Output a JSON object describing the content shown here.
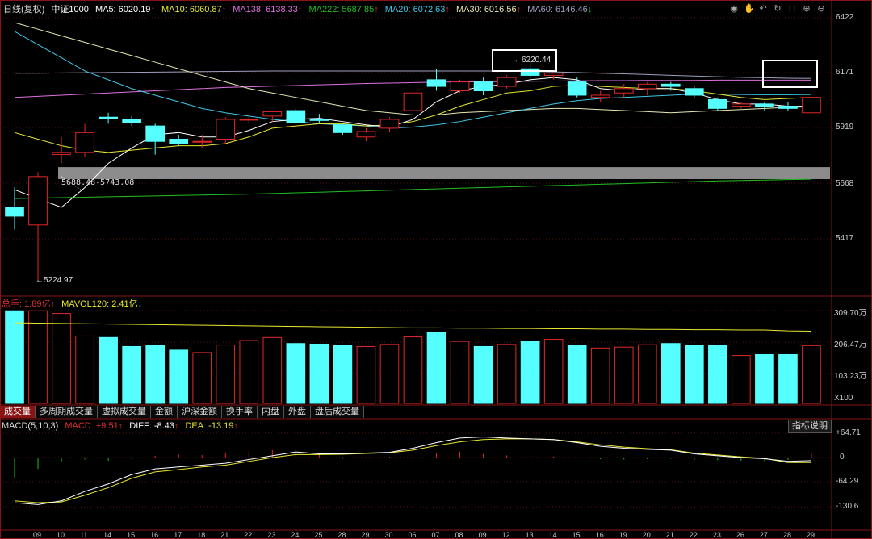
{
  "header": {
    "period": "日线(复权)",
    "index_name": "中证1000",
    "ma5": "MA5: 6020.19",
    "ma10": "MA10: 6060.87",
    "ma138": "MA138: 6138.33",
    "ma222": "MA222: 5687.85",
    "ma20": "MA20: 6072.63",
    "ma30": "MA30: 6016.56",
    "ma60": "MA60: 6146.46",
    "up_arrow": "↑",
    "down_arrow": "↓"
  },
  "toolbar_icons": [
    "eye-icon",
    "hand-icon",
    "undo-icon",
    "refresh-icon",
    "lock-icon",
    "zoom-in-icon",
    "zoom-out-icon"
  ],
  "price_axis": [
    "6422",
    "6171",
    "5919",
    "5668",
    "5417"
  ],
  "annotations": {
    "high_label": "6220.44",
    "low_label": "5224.97",
    "gap_label": "5688.48-5743.08"
  },
  "volume_header": {
    "total": "总手: 1.89亿",
    "mavol": "MAVOL120: 2.41亿"
  },
  "volume_axis": [
    "309.70万",
    "206.47万",
    "103.23万",
    "X100"
  ],
  "tabs": [
    "成交量",
    "多周期成交量",
    "虚拟成交量",
    "金额",
    "沪深金额",
    "换手率",
    "内盘",
    "外盘",
    "盘后成交量"
  ],
  "macd_header": {
    "name": "MACD(5,10,3)",
    "macd": "MACD: +9.51",
    "diff": "DIFF: -8.43",
    "dea": "DEA: -13.19"
  },
  "indicator_button": "指标说明",
  "macd_axis": [
    "+64.71",
    "0",
    "-64.29",
    "-130.6"
  ],
  "date_axis": [
    "09",
    "10",
    "11",
    "14",
    "15",
    "16",
    "17",
    "18",
    "21",
    "22",
    "23",
    "24",
    "25",
    "28",
    "29",
    "30",
    "06",
    "07",
    "08",
    "09",
    "12",
    "13",
    "14",
    "15",
    "16",
    "19",
    "20",
    "21",
    "22",
    "23",
    "26",
    "27",
    "28",
    "29"
  ],
  "colors": {
    "up": "#e02828",
    "down": "#55ffff",
    "ma5": "#ffffff",
    "ma10": "#e8e830",
    "ma20": "#40c8e8",
    "ma30": "#e8e8b0",
    "ma60": "#a0a0c0",
    "ma138": "#e070e0",
    "ma222": "#20c020",
    "diff": "#ffffff",
    "dea": "#e8e830"
  },
  "chart_data": {
    "type": "candlestick",
    "price_range": [
      5224.97,
      6422
    ],
    "candles": [
      {
        "o": 5560,
        "h": 5650,
        "l": 5460,
        "c": 5520
      },
      {
        "o": 5480,
        "h": 5720,
        "l": 5225,
        "c": 5700
      },
      {
        "o": 5800,
        "h": 5880,
        "l": 5760,
        "c": 5810
      },
      {
        "o": 5810,
        "h": 5940,
        "l": 5790,
        "c": 5900
      },
      {
        "o": 5970,
        "h": 5990,
        "l": 5940,
        "c": 5965
      },
      {
        "o": 5960,
        "h": 5975,
        "l": 5930,
        "c": 5945
      },
      {
        "o": 5930,
        "h": 5940,
        "l": 5800,
        "c": 5860
      },
      {
        "o": 5870,
        "h": 5890,
        "l": 5840,
        "c": 5850
      },
      {
        "o": 5860,
        "h": 5890,
        "l": 5830,
        "c": 5860
      },
      {
        "o": 5870,
        "h": 5970,
        "l": 5850,
        "c": 5960
      },
      {
        "o": 5960,
        "h": 5985,
        "l": 5940,
        "c": 5960
      },
      {
        "o": 5975,
        "h": 6000,
        "l": 5950,
        "c": 5995
      },
      {
        "o": 6000,
        "h": 6010,
        "l": 5940,
        "c": 5945
      },
      {
        "o": 5960,
        "h": 5985,
        "l": 5940,
        "c": 5955
      },
      {
        "o": 5935,
        "h": 5945,
        "l": 5890,
        "c": 5900
      },
      {
        "o": 5880,
        "h": 5920,
        "l": 5860,
        "c": 5905
      },
      {
        "o": 5920,
        "h": 5970,
        "l": 5900,
        "c": 5960
      },
      {
        "o": 6000,
        "h": 6090,
        "l": 5980,
        "c": 6080
      },
      {
        "o": 6140,
        "h": 6190,
        "l": 6090,
        "c": 6110
      },
      {
        "o": 6090,
        "h": 6140,
        "l": 6080,
        "c": 6130
      },
      {
        "o": 6130,
        "h": 6150,
        "l": 6070,
        "c": 6090
      },
      {
        "o": 6110,
        "h": 6160,
        "l": 6100,
        "c": 6150
      },
      {
        "o": 6190,
        "h": 6220,
        "l": 6140,
        "c": 6160
      },
      {
        "o": 6160,
        "h": 6180,
        "l": 6140,
        "c": 6170
      },
      {
        "o": 6130,
        "h": 6150,
        "l": 6060,
        "c": 6070
      },
      {
        "o": 6060,
        "h": 6090,
        "l": 6040,
        "c": 6070
      },
      {
        "o": 6080,
        "h": 6120,
        "l": 6060,
        "c": 6100
      },
      {
        "o": 6100,
        "h": 6130,
        "l": 6070,
        "c": 6120
      },
      {
        "o": 6120,
        "h": 6130,
        "l": 6090,
        "c": 6110
      },
      {
        "o": 6100,
        "h": 6110,
        "l": 6060,
        "c": 6070
      },
      {
        "o": 6050,
        "h": 6060,
        "l": 6000,
        "c": 6010
      },
      {
        "o": 6020,
        "h": 6040,
        "l": 6010,
        "c": 6030
      },
      {
        "o": 6030,
        "h": 6040,
        "l": 6000,
        "c": 6020
      },
      {
        "o": 6020,
        "h": 6040,
        "l": 6000,
        "c": 6010
      },
      {
        "o": 5990,
        "h": 6060,
        "l": 5990,
        "c": 6060
      }
    ],
    "ma_lines": {
      "ma5": [
        5640,
        5600,
        5560,
        5650,
        5760,
        5830,
        5890,
        5900,
        5880,
        5880,
        5910,
        5950,
        5960,
        5965,
        5950,
        5935,
        5925,
        5960,
        6040,
        6090,
        6110,
        6120,
        6140,
        6150,
        6140,
        6100,
        6090,
        6100,
        6100,
        6080,
        6050,
        6030,
        6030,
        6020,
        6020
      ],
      "ma10": [
        5900,
        5870,
        5840,
        5820,
        5810,
        5820,
        5830,
        5840,
        5840,
        5850,
        5880,
        5920,
        5930,
        5940,
        5940,
        5930,
        5935,
        5950,
        5980,
        6020,
        6050,
        6080,
        6090,
        6110,
        6115,
        6110,
        6105,
        6100,
        6100,
        6090,
        6075,
        6060,
        6050,
        6055,
        6060
      ],
      "ma20": [
        6360,
        6300,
        6240,
        6180,
        6140,
        6100,
        6070,
        6040,
        6010,
        5990,
        5975,
        5960,
        5950,
        5940,
        5935,
        5930,
        5920,
        5925,
        5935,
        5950,
        5970,
        5990,
        6010,
        6030,
        6045,
        6055,
        6060,
        6065,
        6070,
        6075,
        6075,
        6073,
        6072,
        6072,
        6073
      ],
      "ma30": [
        6400,
        6370,
        6340,
        6310,
        6280,
        6250,
        6220,
        6190,
        6160,
        6130,
        6100,
        6080,
        6060,
        6040,
        6020,
        6000,
        5990,
        5980,
        5980,
        5990,
        5995,
        6000,
        6005,
        6010,
        6010,
        6005,
        6000,
        5995,
        5990,
        5995,
        6000,
        6005,
        6010,
        6015,
        6017
      ],
      "ma60": [
        6170,
        6170,
        6171,
        6172,
        6173,
        6174,
        6175,
        6176,
        6177,
        6178,
        6179,
        6180,
        6180,
        6180,
        6180,
        6180,
        6180,
        6180,
        6180,
        6180,
        6180,
        6180,
        6178,
        6176,
        6173,
        6170,
        6167,
        6164,
        6160,
        6157,
        6154,
        6151,
        6149,
        6147,
        6146
      ],
      "ma138": [
        6060,
        6065,
        6070,
        6075,
        6080,
        6085,
        6090,
        6095,
        6100,
        6105,
        6108,
        6111,
        6114,
        6117,
        6120,
        6123,
        6125,
        6127,
        6129,
        6130,
        6131,
        6132,
        6133,
        6134,
        6135,
        6136,
        6136,
        6137,
        6137,
        6137,
        6138,
        6138,
        6138,
        6138,
        6138
      ],
      "ma222": [
        5600,
        5602,
        5604,
        5606,
        5608,
        5610,
        5612,
        5614,
        5616,
        5618,
        5620,
        5623,
        5626,
        5629,
        5632,
        5635,
        5638,
        5641,
        5644,
        5647,
        5650,
        5653,
        5656,
        5659,
        5662,
        5665,
        5668,
        5671,
        5674,
        5677,
        5680,
        5682,
        5684,
        5686,
        5688
      ]
    },
    "volume": [
      309,
      309,
      300,
      225,
      220,
      190,
      193,
      178,
      170,
      195,
      210,
      220,
      200,
      198,
      195,
      190,
      197,
      222,
      237,
      207,
      190,
      197,
      207,
      214,
      195,
      185,
      188,
      196,
      200,
      195,
      193,
      160,
      163,
      163,
      193
    ],
    "volume_ma": [
      269,
      268,
      267,
      266,
      265,
      264,
      263,
      262,
      261,
      260,
      259,
      258,
      257,
      256,
      255,
      254,
      253,
      252,
      252,
      251,
      251,
      250,
      250,
      249,
      249,
      248,
      248,
      247,
      247,
      246,
      246,
      245,
      245,
      242,
      241
    ],
    "macd_hist": [
      -55,
      -30,
      -10,
      -5,
      -8,
      -4,
      5,
      9,
      7,
      12,
      16,
      20,
      22,
      8,
      -3,
      -2,
      2,
      6,
      12,
      16,
      10,
      6,
      4,
      3,
      -2,
      -4,
      -5,
      -4,
      -3,
      -6,
      -7,
      -8,
      -9,
      -6,
      9.5
    ],
    "diff": [
      -120,
      -125,
      -115,
      -90,
      -70,
      -45,
      -30,
      -25,
      -20,
      -15,
      -5,
      5,
      15,
      10,
      10,
      12,
      14,
      25,
      40,
      52,
      55,
      52,
      50,
      48,
      40,
      30,
      25,
      22,
      20,
      10,
      5,
      0,
      -3,
      -10,
      -8
    ],
    "dea": [
      -115,
      -120,
      -118,
      -100,
      -80,
      -55,
      -38,
      -32,
      -25,
      -20,
      -10,
      0,
      8,
      8,
      9,
      11,
      13,
      20,
      32,
      42,
      48,
      50,
      50,
      48,
      42,
      34,
      28,
      24,
      21,
      12,
      7,
      2,
      -2,
      -13,
      -13
    ]
  }
}
